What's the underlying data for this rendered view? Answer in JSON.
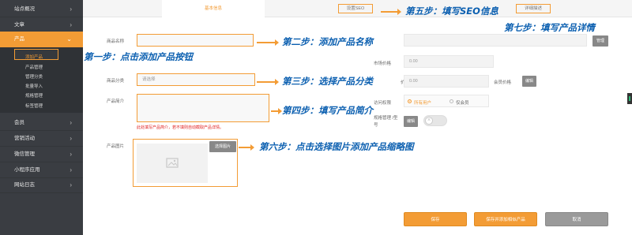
{
  "sidebar": {
    "top_items": [
      {
        "label": "站点概况"
      },
      {
        "label": "文章"
      },
      {
        "label": "产品"
      }
    ],
    "sub_items": [
      {
        "label": "添加产品"
      },
      {
        "label": "产品管理"
      },
      {
        "label": "管理分类"
      },
      {
        "label": "批量导入"
      },
      {
        "label": "规格管理"
      },
      {
        "label": "标签管理"
      }
    ],
    "bottom_items": [
      {
        "label": "会员"
      },
      {
        "label": "营销活动"
      },
      {
        "label": "微信管理"
      },
      {
        "label": "小程序应用"
      },
      {
        "label": "网站日志"
      }
    ]
  },
  "tabs": {
    "basic": "基本信息",
    "seo": "设置SEO",
    "detail": "详细描述"
  },
  "form": {
    "name_label": "商品名称",
    "category_label": "商品分类",
    "category_placeholder": "请选择",
    "intro_label": "产品简介",
    "intro_hint": "此处填写产品简介，若不填则自动截取产品详情。",
    "image_label": "产品图片",
    "choose_image": "选择图片",
    "manage_btn": "管理",
    "market_price_label": "市场价格",
    "market_price": "0.00",
    "price_label": "价格",
    "price": "0.00",
    "member_price_label": "会员价格",
    "edit_btn": "编辑",
    "access_label": "访问权限",
    "access_all": "所有用户",
    "access_member": "仅会员",
    "spec_label": "规格管理 /型号",
    "spec_edit": "编辑"
  },
  "actions": {
    "save": "保存",
    "save_continue": "保存并添加相似产品",
    "cancel": "取消"
  },
  "annotations": {
    "step1": "第一步：点击添加产品按钮",
    "step2": "第二步：添加产品名称",
    "step3": "第三步：选择产品分类",
    "step4": "第四步：填写产品简介",
    "step5": "第五步：填写SEO信息",
    "step6": "第六步：点击选择图片添加产品缩略图",
    "step7": "第七步：填写产品详情"
  },
  "colors": {
    "accent": "#f39c35",
    "sidebar_bg": "#3a3d42",
    "annotation": "#0b5fb0"
  }
}
